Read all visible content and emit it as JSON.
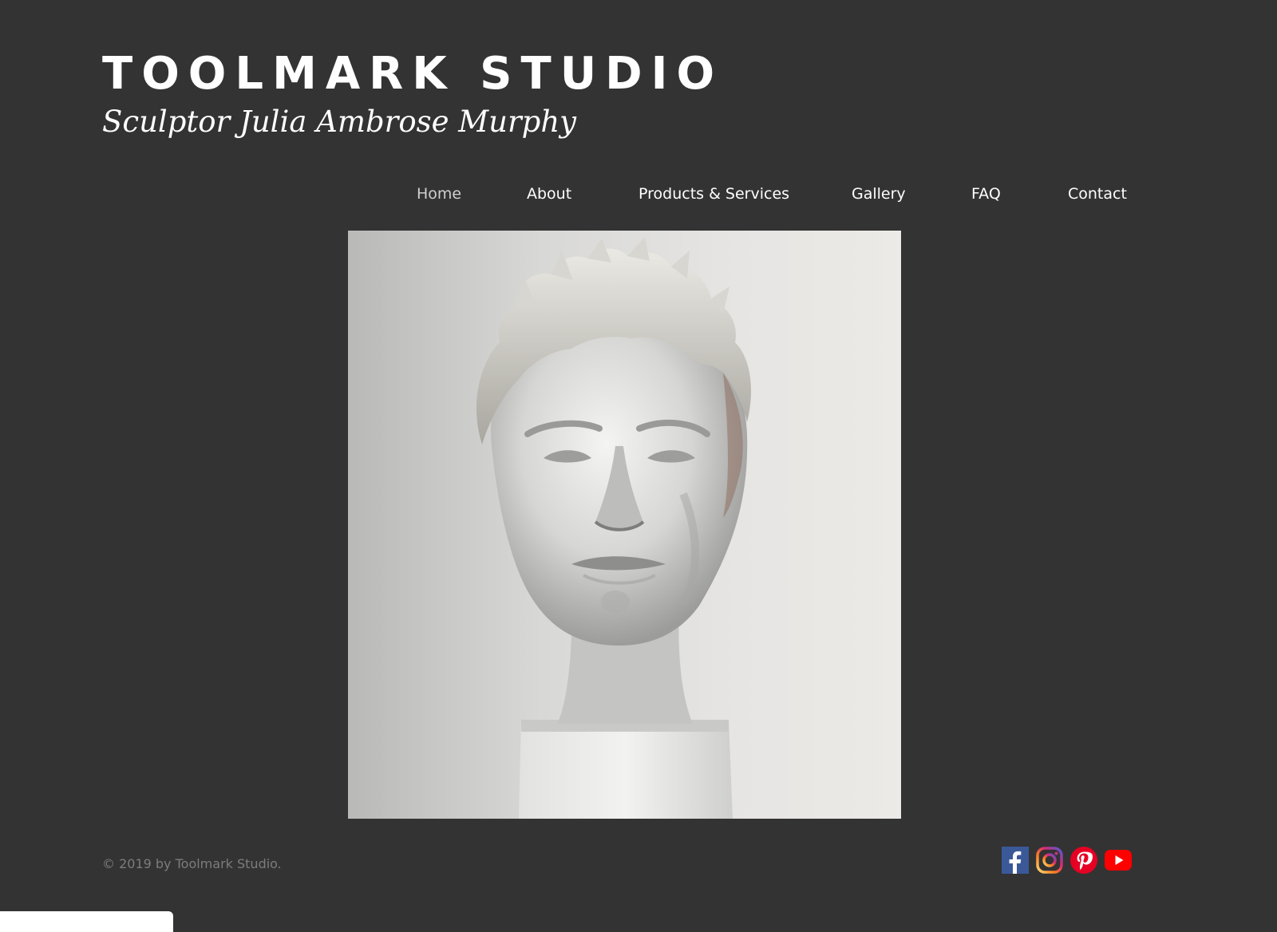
{
  "header": {
    "title": "TOOLMARK STUDIO",
    "subtitle": "Sculptor Julia Ambrose Murphy"
  },
  "nav": {
    "items": [
      {
        "label": "Home",
        "active": true
      },
      {
        "label": "About"
      },
      {
        "label": "Products & Services"
      },
      {
        "label": "Gallery"
      },
      {
        "label": "FAQ"
      },
      {
        "label": "Contact"
      }
    ]
  },
  "hero": {
    "icon": "sculpture-bust-image"
  },
  "footer": {
    "copyright": "© 2019 by Toolmark Studio.",
    "social": [
      {
        "name": "facebook-icon",
        "color": "#3b5998"
      },
      {
        "name": "instagram-icon",
        "color": "#c13584"
      },
      {
        "name": "pinterest-icon",
        "color": "#e60023"
      },
      {
        "name": "youtube-icon",
        "color": "#ff0000"
      }
    ]
  },
  "colors": {
    "background": "#333333",
    "text": "#ffffff",
    "muted": "#7c7c7c"
  }
}
